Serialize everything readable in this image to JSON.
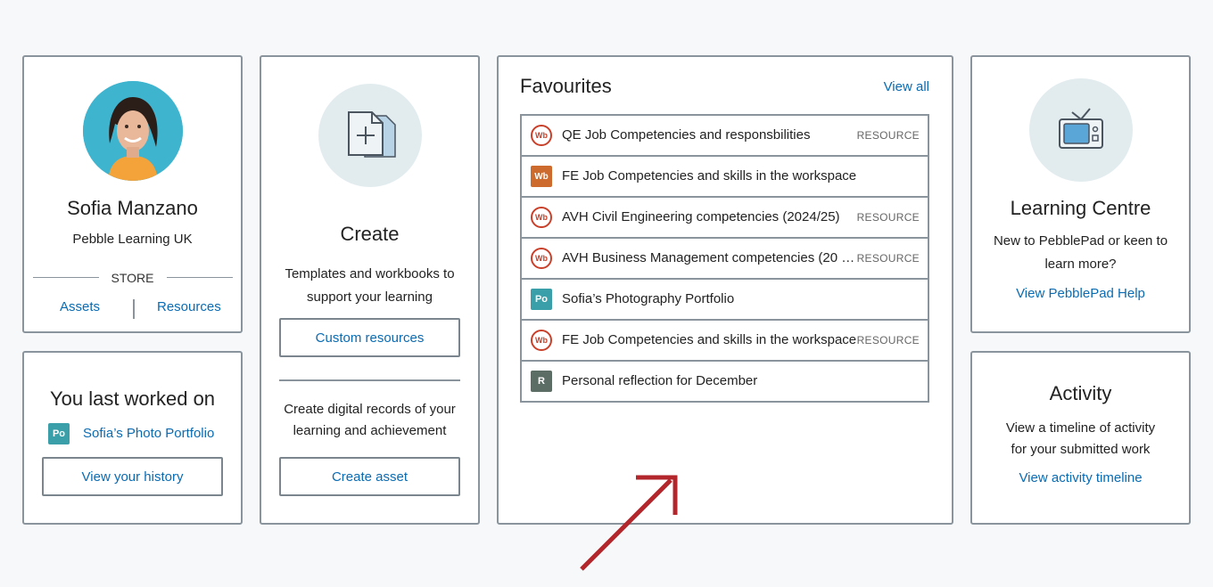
{
  "profile": {
    "name": "Sofia Manzano",
    "org": "Pebble Learning UK",
    "store_label": "STORE",
    "assets_link": "Assets",
    "resources_link": "Resources"
  },
  "last_worked": {
    "heading": "You last worked on",
    "badge": "Po",
    "item_label": "Sofia’s Photo Portfolio",
    "history_button": "View your history"
  },
  "create": {
    "heading": "Create",
    "templates_text_1": "Templates and workbooks to",
    "templates_text_2": "support your learning",
    "custom_button": "Custom resources",
    "records_text_1": "Create digital records of your",
    "records_text_2": "learning and achievement",
    "asset_button": "Create asset"
  },
  "favourites": {
    "heading": "Favourites",
    "view_all": "View all",
    "items": [
      {
        "icon": "Wb",
        "type": "workbook-resource",
        "title": "QE Job Competencies and responsbilities",
        "tag": "RESOURCE"
      },
      {
        "icon": "Wb",
        "type": "workbook",
        "title": "FE Job Competencies and skills in the workspace",
        "tag": ""
      },
      {
        "icon": "Wb",
        "type": "workbook-resource",
        "title": "AVH Civil Engineering competencies (2024/25)",
        "tag": "RESOURCE"
      },
      {
        "icon": "Wb",
        "type": "workbook-resource",
        "title": "AVH Business Management competencies (20 …",
        "tag": "RESOURCE"
      },
      {
        "icon": "Po",
        "type": "portfolio",
        "title": "Sofia’s Photography Portfolio",
        "tag": ""
      },
      {
        "icon": "Wb",
        "type": "workbook-resource",
        "title": "FE Job Competencies and skills in the workspace",
        "tag": "RESOURCE"
      },
      {
        "icon": "R",
        "type": "reflection",
        "title": "Personal reflection for December",
        "tag": ""
      }
    ]
  },
  "learning_centre": {
    "heading": "Learning Centre",
    "text_1": "New to PebblePad or keen to",
    "text_2": "learn more?",
    "link": "View PebblePad Help"
  },
  "activity": {
    "heading": "Activity",
    "text_1": "View a timeline of activity",
    "text_2": "for your submitted work",
    "link": "View activity timeline"
  },
  "colors": {
    "link": "#0a6bb3",
    "border": "#8a949c",
    "arrow": "#b3262b",
    "workbook": "#c9402a",
    "portfolio": "#3a9fa8",
    "reflection": "#5c6d66"
  },
  "icons": [
    "new-document-icon",
    "tv-icon",
    "annotation-arrow"
  ]
}
